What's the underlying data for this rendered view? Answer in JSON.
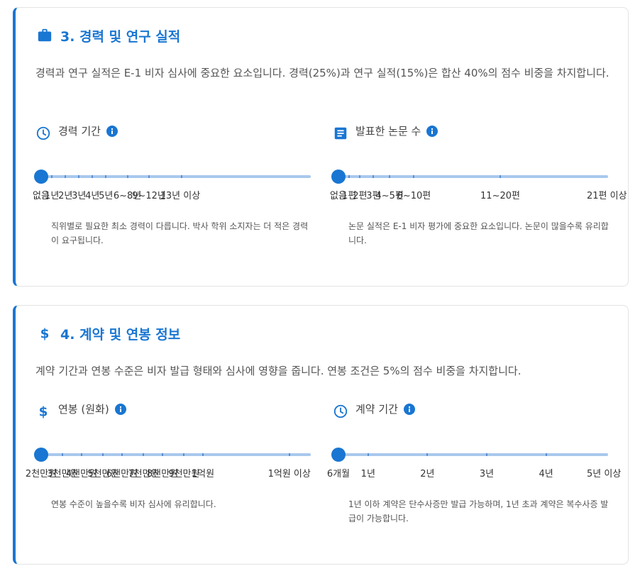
{
  "section3": {
    "title": "3. 경력 및 연구 실적",
    "description": "경력과 연구 실적은 E-1 비자 심사에 중요한 요소입니다. 경력(25%)과 연구 실적(15%)은 합산 40%의 점수 비중을 차지합니다.",
    "experience": {
      "label": "경력 기간",
      "value_index": 0,
      "marks": [
        "없음",
        "1년",
        "2년",
        "3년",
        "4년",
        "5년",
        "6~8년",
        "9~12년",
        "13년 이상"
      ],
      "help": "직위별로 필요한 최소 경력이 다릅니다. 박사 학위 소지자는 더 적은 경력이 요구됩니다."
    },
    "papers": {
      "label": "발표한 논문 수",
      "value_index": 0,
      "marks": [
        "없음",
        "1편",
        "2편",
        "3편",
        "4~5편",
        "6~10편",
        "11~20편",
        "21편 이상"
      ],
      "help": "논문 실적은 E-1 비자 평가에 중요한 요소입니다. 논문이 많을수록 유리합니다."
    }
  },
  "section4": {
    "title": "4. 계약 및 연봉 정보",
    "description": "계약 기간과 연봉 수준은 비자 발급 형태와 심사에 영향을 줍니다. 연봉 조건은 5%의 점수 비중을 차지합니다.",
    "salary": {
      "label": "연봉 (원화)",
      "value_index": 0,
      "marks": [
        "2천만원",
        "3천만원",
        "4천만원",
        "5천만원",
        "6천만원",
        "7천만원",
        "8천만원",
        "9천만원",
        "1억원",
        "1억원 이상"
      ],
      "help": "연봉 수준이 높을수록 비자 심사에 유리합니다."
    },
    "contract": {
      "label": "계약 기간",
      "value_index": 0,
      "marks": [
        "6개월",
        "1년",
        "2년",
        "3년",
        "4년",
        "5년 이상"
      ],
      "help": "1년 이하 계약은 단수사증만 발급 가능하며, 1년 초과 계약은 복수사증 발급이 가능합니다."
    }
  },
  "colors": {
    "accent": "#1976d2",
    "track": "#a9c8ec"
  }
}
